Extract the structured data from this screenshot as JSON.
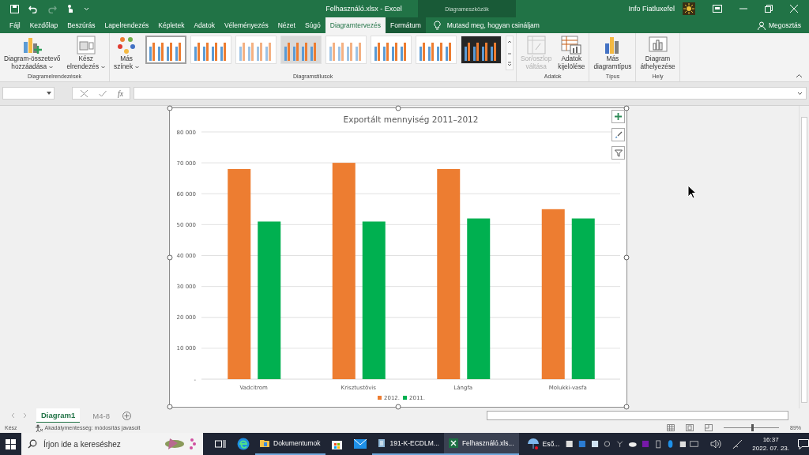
{
  "title_bar": {
    "title": "Felhasználó.xlsx  -  Excel",
    "context_header": "Diagrameszközök",
    "user": "Info Fiatluxefel"
  },
  "ribbon_tabs": [
    {
      "label": "Fájl",
      "selected": false,
      "contextual": false
    },
    {
      "label": "Kezdőlap",
      "selected": false,
      "contextual": false
    },
    {
      "label": "Beszúrás",
      "selected": false,
      "contextual": false
    },
    {
      "label": "Lapelrendezés",
      "selected": false,
      "contextual": false
    },
    {
      "label": "Képletek",
      "selected": false,
      "contextual": false
    },
    {
      "label": "Adatok",
      "selected": false,
      "contextual": false
    },
    {
      "label": "Véleményezés",
      "selected": false,
      "contextual": false
    },
    {
      "label": "Nézet",
      "selected": false,
      "contextual": false
    },
    {
      "label": "Súgó",
      "selected": false,
      "contextual": false
    },
    {
      "label": "Diagramtervezés",
      "selected": true,
      "contextual": true
    },
    {
      "label": "Formátum",
      "selected": false,
      "contextual": true
    }
  ],
  "tell_me": "Mutasd meg, hogyan csináljam",
  "share": "Megosztás",
  "ribbon_groups": [
    {
      "label": "Diagramelrendezések",
      "buttons": [
        {
          "label_lines": [
            "Diagram-összetevő",
            "hozzáadása"
          ],
          "dropdown": true,
          "disabled": false
        },
        {
          "label_lines": [
            "Kész",
            "elrendezés"
          ],
          "dropdown": true,
          "disabled": false
        }
      ]
    },
    {
      "label": "Diagramstílusok",
      "buttons": [
        {
          "label_lines": [
            "Más",
            "színek"
          ],
          "dropdown": true,
          "disabled": false
        }
      ],
      "gallery": [
        {
          "kind": "plain",
          "selected": true
        },
        {
          "kind": "plain",
          "selected": false
        },
        {
          "kind": "light",
          "selected": false
        },
        {
          "kind": "gray",
          "selected": false
        },
        {
          "kind": "light",
          "selected": false
        },
        {
          "kind": "plain",
          "selected": false
        },
        {
          "kind": "plain",
          "selected": false
        },
        {
          "kind": "dark",
          "selected": false
        }
      ]
    },
    {
      "label": "Adatok",
      "buttons": [
        {
          "label_lines": [
            "Sor/oszlop",
            "váltása"
          ],
          "dropdown": false,
          "disabled": true
        },
        {
          "label_lines": [
            "Adatok",
            "kijelölése"
          ],
          "dropdown": false,
          "disabled": false
        }
      ]
    },
    {
      "label": "Típus",
      "buttons": [
        {
          "label_lines": [
            "Más",
            "diagramtípus"
          ],
          "dropdown": false,
          "disabled": false
        }
      ]
    },
    {
      "label": "Hely",
      "buttons": [
        {
          "label_lines": [
            "Diagram",
            "áthelyezése"
          ],
          "dropdown": false,
          "disabled": false
        }
      ]
    }
  ],
  "formula_bar": {
    "function_label": "fx"
  },
  "chart": {
    "chart_data": {
      "type": "bar",
      "title": "Exportált mennyiség 2011–2012",
      "categories": [
        "Vadcitrom",
        "Krisztustövis",
        "Lángfa",
        "Molukki-vasfa"
      ],
      "series": [
        {
          "name": "2012.",
          "color": "#ed7d31",
          "values": [
            68000,
            70000,
            68000,
            55000
          ]
        },
        {
          "name": "2011.",
          "color": "#00b050",
          "values": [
            51000,
            51000,
            52000,
            52000
          ]
        }
      ],
      "ylim": [
        0,
        80000
      ],
      "yticks": [
        {
          "value": 0,
          "label": "-"
        },
        {
          "value": 10000,
          "label": "10 000"
        },
        {
          "value": 20000,
          "label": "20 000"
        },
        {
          "value": 30000,
          "label": "30 000"
        },
        {
          "value": 40000,
          "label": "40 000"
        },
        {
          "value": 50000,
          "label": "50 000"
        },
        {
          "value": 60000,
          "label": "60 000"
        },
        {
          "value": 70000,
          "label": "70 000"
        },
        {
          "value": 80000,
          "label": "80 000"
        }
      ],
      "grid": true,
      "legend": true
    }
  },
  "sheet_tabs": [
    {
      "label": "Diagram1",
      "selected": true
    },
    {
      "label": "M4-8",
      "selected": false
    }
  ],
  "status_bar": {
    "ready": "Kész",
    "accessibility": "Akadálymentesség: módosítás javasolt",
    "zoom": "89%",
    "zoom_slider": {
      "level": 0.5
    }
  },
  "taskbar": {
    "search_placeholder": "Írjon ide a kereséshez",
    "apps": [
      {
        "label": "Dokumentumok",
        "active": false
      },
      {
        "label": "191-K-ECDLM...",
        "active": false
      },
      {
        "label": "Felhasználó.xls...",
        "active": true
      }
    ],
    "weather": "Eső...",
    "time": "16:37",
    "date": "2022. 07. 23."
  }
}
